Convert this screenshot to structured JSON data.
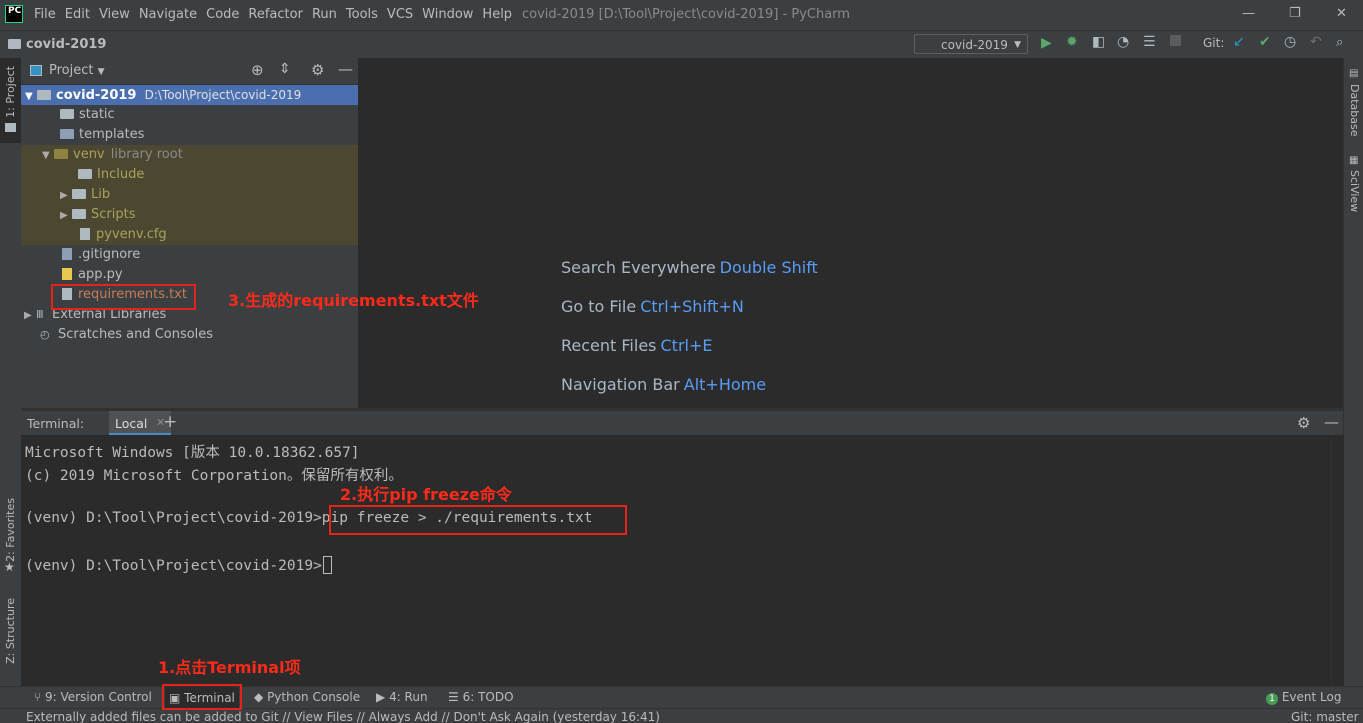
{
  "menubar": {
    "logo": "PC",
    "items": [
      "File",
      "Edit",
      "View",
      "Navigate",
      "Code",
      "Refactor",
      "Run",
      "Tools",
      "VCS",
      "Window",
      "Help"
    ],
    "title": "covid-2019 [D:\\Tool\\Project\\covid-2019] - PyCharm"
  },
  "navbar": {
    "project": "covid-2019",
    "run_config": "covid-2019",
    "git_label": "Git:"
  },
  "left_strip": {
    "project": "1: Project",
    "favorites": "2: Favorites",
    "structure": "Z: Structure"
  },
  "right_strip": {
    "database": "Database",
    "sciview": "SciView"
  },
  "project_panel": {
    "header": "Project",
    "tree": [
      {
        "name": "covid-2019",
        "path": "D:\\Tool\\Project\\covid-2019"
      },
      {
        "name": "static"
      },
      {
        "name": "templates"
      },
      {
        "name": "venv",
        "suffix": "library root"
      },
      {
        "name": "Include"
      },
      {
        "name": "Lib"
      },
      {
        "name": "Scripts"
      },
      {
        "name": "pyvenv.cfg"
      },
      {
        "name": ".gitignore"
      },
      {
        "name": "app.py"
      },
      {
        "name": "requirements.txt"
      },
      {
        "name": "External Libraries"
      },
      {
        "name": "Scratches and Consoles"
      }
    ]
  },
  "editor_hints": [
    {
      "label": "Search Everywhere",
      "key": "Double Shift"
    },
    {
      "label": "Go to File",
      "key": "Ctrl+Shift+N"
    },
    {
      "label": "Recent Files",
      "key": "Ctrl+E"
    },
    {
      "label": "Navigation Bar",
      "key": "Alt+Home"
    }
  ],
  "terminal": {
    "label": "Terminal:",
    "tab": "Local",
    "lines": [
      "Microsoft Windows [版本 10.0.18362.657]",
      "(c) 2019 Microsoft Corporation。保留所有权利。",
      "(venv) D:\\Tool\\Project\\covid-2019>pip freeze > ./requirements.txt",
      "(venv) D:\\Tool\\Project\\covid-2019>"
    ]
  },
  "annotations": {
    "a1": "1.点击Terminal项",
    "a2": "2.执行pip freeze命令",
    "a3": "3.生成的requirements.txt文件"
  },
  "bottom_tools": {
    "version_control": "9: Version Control",
    "terminal": "Terminal",
    "python_console": "Python Console",
    "run": "4: Run",
    "todo": "6: TODO",
    "event_log": "Event Log"
  },
  "status": {
    "message": "Externally added files can be added to Git // View Files // Always Add // Don't Ask Again (yesterday 16:41)",
    "git": "Git: master"
  },
  "colors": {
    "accent_blue": "#589df6",
    "selection": "#4b6eaf",
    "annotation_red": "#ff2a1a",
    "library_bg": "#4b4731"
  }
}
